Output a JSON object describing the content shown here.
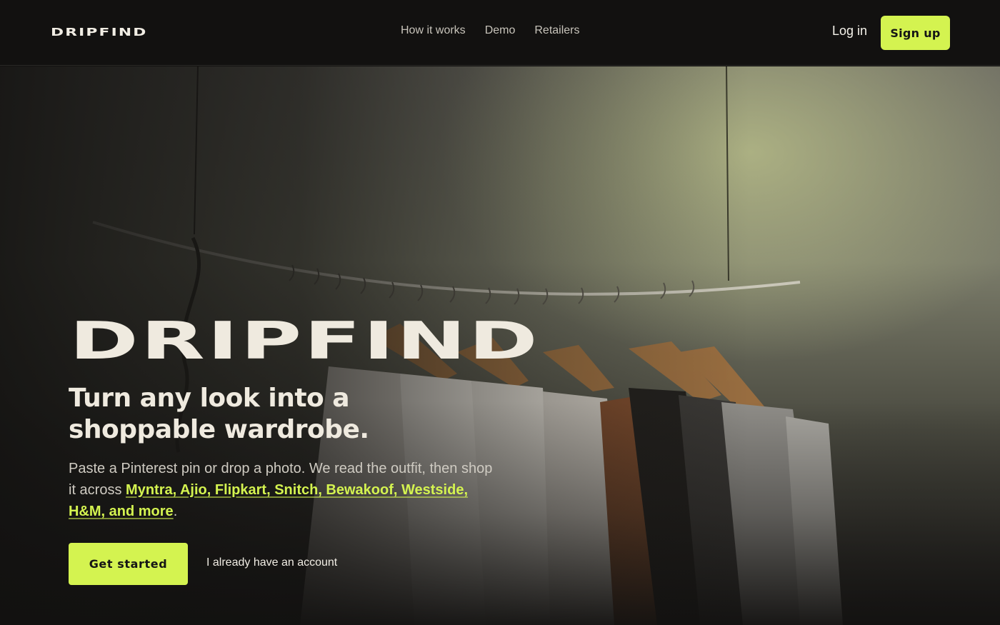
{
  "nav": {
    "logo": "DRIPFIND",
    "links": [
      "How it works",
      "Demo",
      "Retailers"
    ],
    "login_label": "Log in",
    "signup_label": "Sign up"
  },
  "hero": {
    "brand": "DRIPFIND",
    "headline": "Turn any look into a shoppable wardrobe.",
    "subtext_before": "Paste a Pinterest pin or drop a photo. We read the outfit, then shop it across ",
    "retailers_link": "Myntra, Ajio, Flipkart, Snitch, Bewakoof, Westside, H&M, and more",
    "subtext_after": ".",
    "cta_label": "Get started",
    "secondary_label": "I already have an account",
    "background_image": "clothes-rack-photo"
  },
  "colors": {
    "accent": "#d4f350",
    "background": "#121110",
    "text": "#efeadf"
  }
}
